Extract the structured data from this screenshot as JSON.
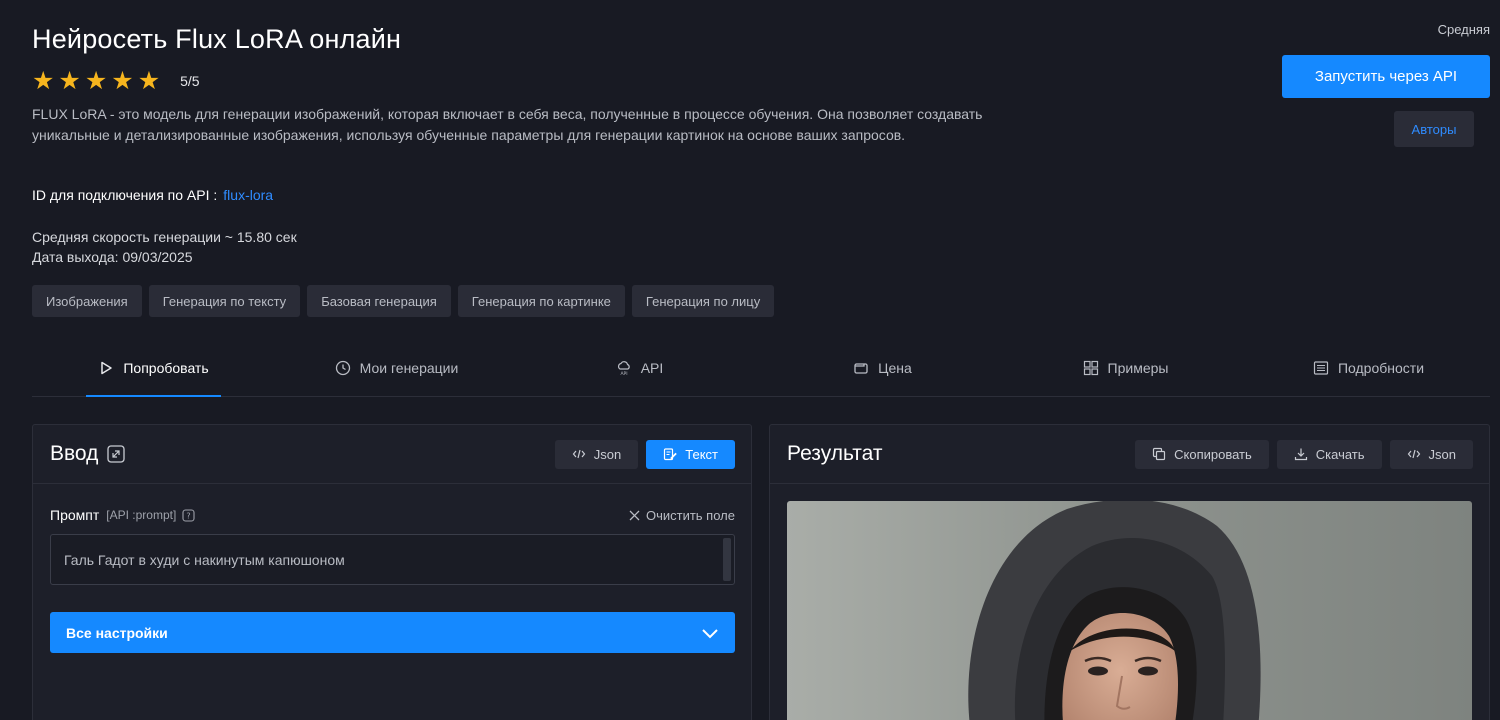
{
  "header": {
    "title": "Нейросеть Flux LoRA онлайн",
    "rating_stars": 5,
    "rating_text": "5/5",
    "description": "FLUX LoRA - это модель для генерации изображений, которая включает в себя веса, полученные в процессе обучения. Она позволяет создавать уникальные и детализированные изображения, используя обученные параметры для генерации картинок на основе ваших запросов.",
    "api_id_label": "ID для подключения по API :",
    "api_id_value": "flux-lora",
    "speed": "Средняя скорость генерации ~ 15.80 сек",
    "release": "Дата выхода: 09/03/2025",
    "quality": "Средняя",
    "run_button": "Запустить через API",
    "authors_button": "Авторы"
  },
  "tags": [
    "Изображения",
    "Генерация по тексту",
    "Базовая генерация",
    "Генерация по картинке",
    "Генерация по лицу"
  ],
  "tabs": [
    {
      "label": "Попробовать",
      "icon": "play-icon",
      "active": true
    },
    {
      "label": "Мои генерации",
      "icon": "history-icon",
      "active": false
    },
    {
      "label": "API",
      "icon": "api-cloud-icon",
      "active": false
    },
    {
      "label": "Цена",
      "icon": "wallet-icon",
      "active": false
    },
    {
      "label": "Примеры",
      "icon": "grid-icon",
      "active": false
    },
    {
      "label": "Подробности",
      "icon": "details-icon",
      "active": false
    }
  ],
  "input_panel": {
    "title": "Ввод",
    "json_button": "Json",
    "text_button": "Текст",
    "prompt_label": "Промпт",
    "prompt_api": "[API :prompt]",
    "clear_label": "Очистить поле",
    "prompt_value": "Галь Гадот в худи с накинутым капюшоном",
    "settings_label": "Все настройки"
  },
  "result_panel": {
    "title": "Результат",
    "copy_button": "Скопировать",
    "download_button": "Скачать",
    "json_button": "Json"
  },
  "colors": {
    "accent": "#1589ff",
    "star": "#f6b51e",
    "background": "#181a23",
    "link": "#2f8cff"
  }
}
